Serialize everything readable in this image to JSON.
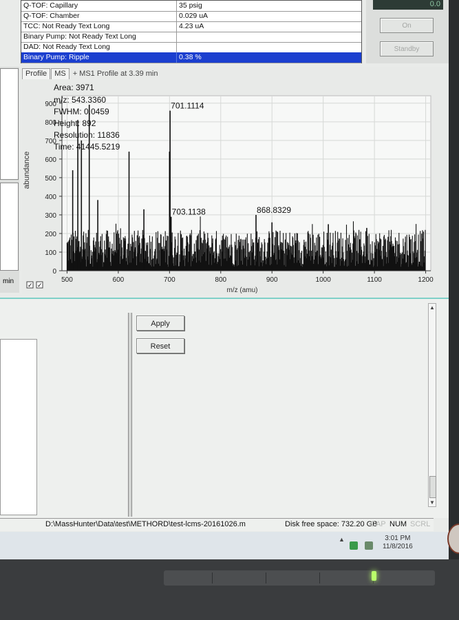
{
  "status_table": {
    "rows": [
      {
        "label": "Q-TOF: Capillary",
        "value": "35 psig"
      },
      {
        "label": "Q-TOF: Chamber",
        "value": "0.029 uA"
      },
      {
        "label": "TCC: Not Ready Text Long",
        "value": "4.23 uA"
      },
      {
        "label": "Binary Pump: Not Ready Text Long",
        "value": ""
      },
      {
        "label": "DAD: Not Ready Text Long",
        "value": ""
      },
      {
        "label": "Binary Pump: Ripple",
        "value": "0.38 %"
      }
    ]
  },
  "right_panel": {
    "display": "0.0",
    "on_button": "On",
    "standby_button": "Standby"
  },
  "left_stub": {
    "unit": "min"
  },
  "plot": {
    "tabs": [
      "Profile",
      "MS"
    ],
    "caption": "+ MS1 Profile at 3.39 min",
    "info": {
      "area": "Area: 3971",
      "mz": "m/z: 543.3360",
      "fwhm": "FWHM: 0.0459",
      "height": "Height: 892",
      "resolution": "Resolution: 11836",
      "time": "Time: 41445.5219"
    }
  },
  "chart_data": {
    "type": "line",
    "xlabel": "m/z (amu)",
    "ylabel": "abundance",
    "xlim": [
      490,
      1210
    ],
    "ylim": [
      0,
      940
    ],
    "x_ticks": [
      500,
      600,
      700,
      800,
      900,
      1000,
      1100,
      1200
    ],
    "y_ticks": [
      0,
      100,
      200,
      300,
      400,
      500,
      600,
      700,
      800,
      900
    ],
    "grid": true,
    "noise_range": [
      500,
      1200
    ],
    "peaks": [
      {
        "x": 511,
        "y": 540
      },
      {
        "x": 521,
        "y": 810
      },
      {
        "x": 528,
        "y": 700
      },
      {
        "x": 543.336,
        "y": 892
      },
      {
        "x": 560,
        "y": 380
      },
      {
        "x": 621,
        "y": 640
      },
      {
        "x": 650,
        "y": 330
      },
      {
        "x": 700,
        "y": 640
      },
      {
        "x": 701.1114,
        "y": 860
      },
      {
        "x": 703.1138,
        "y": 290
      },
      {
        "x": 868.8329,
        "y": 300
      },
      {
        "x": 900,
        "y": 260
      },
      {
        "x": 1010,
        "y": 250
      },
      {
        "x": 1085,
        "y": 230
      }
    ],
    "labels": [
      {
        "text": "701.1114",
        "x": 701.1114,
        "y": 860
      },
      {
        "text": "703.1138",
        "x": 703.1138,
        "y": 290
      },
      {
        "text": "868.8329",
        "x": 868.8329,
        "y": 300
      }
    ]
  },
  "lower": {
    "apply_button": "Apply",
    "reset_button": "Reset"
  },
  "statusbar": {
    "path": "D:\\MassHunter\\Data\\test\\METHORD\\test-lcms-20161026.m",
    "disk": "Disk free space: 732.20 GB",
    "cap": "CAP",
    "num": "NUM",
    "scrl": "SCRL"
  },
  "taskbar": {
    "time": "3:01 PM",
    "date": "11/8/2016"
  },
  "colors": {
    "selection": "#1b3fcf",
    "accent_line": "#7fd0c8",
    "led": "#b9ff6a"
  }
}
